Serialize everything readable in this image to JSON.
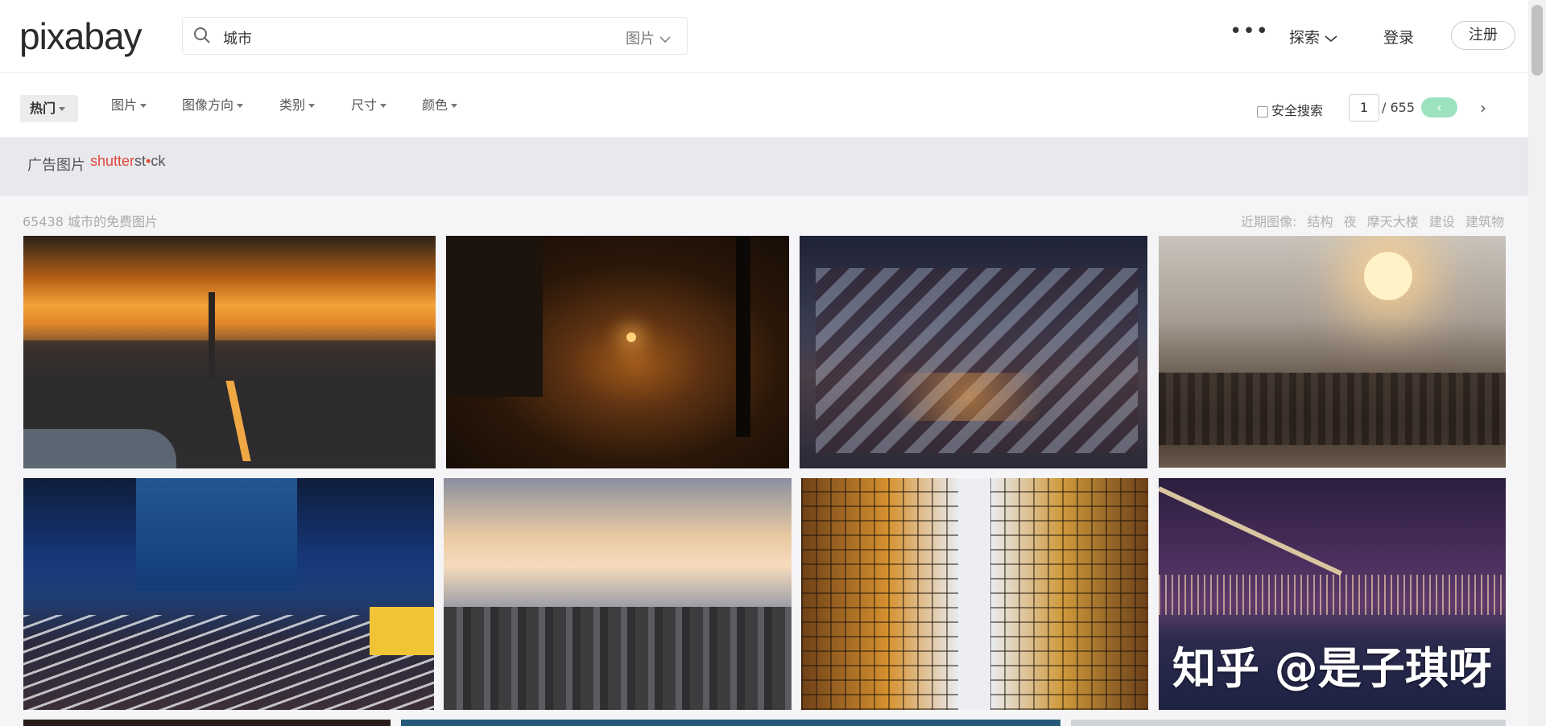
{
  "header": {
    "logo": "pixabay",
    "search_value": "城市",
    "search_type": "图片",
    "nav_more": "•••",
    "nav_explore": "探索",
    "nav_login": "登录",
    "nav_register": "注册"
  },
  "filters": {
    "hot": "热门",
    "image": "图片",
    "orientation": "图像方向",
    "category": "类别",
    "size": "尺寸",
    "color": "颜色"
  },
  "safe_search": "安全搜索",
  "pagination": {
    "current": "1",
    "total": "/ 655",
    "prev": "‹",
    "next": "›"
  },
  "ad": {
    "label": "广告图片",
    "brand_a": "shutter",
    "brand_b": "st",
    "brand_c": "ck"
  },
  "results": {
    "count": "65438 城市的免费图片",
    "recent_label": "近期图像:",
    "recent_tags": [
      "结构",
      "夜",
      "摩天大楼",
      "建设",
      "建筑物"
    ]
  },
  "watermark": "知乎 @是子琪呀",
  "colors": {
    "accent_green": "#9ce2bf",
    "shutterstock_red": "#e2473c"
  }
}
